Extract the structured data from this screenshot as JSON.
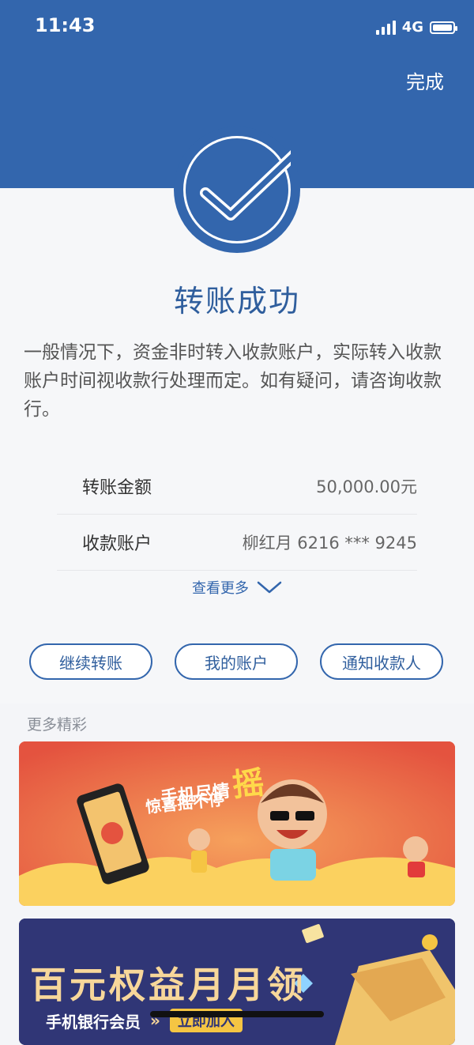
{
  "status_bar": {
    "time": "11:43",
    "network": "4G"
  },
  "header": {
    "done_label": "完成"
  },
  "result": {
    "title": "转账成功",
    "description": "一般情况下，资金非时转入收款账户，实际转入收款账户时间视收款行处理而定。如有疑问，请咨询收款行。"
  },
  "details": [
    {
      "label": "转账金额",
      "value": "50,000.00元"
    },
    {
      "label": "收款账户",
      "value": "柳红月 6216 *** 9245"
    }
  ],
  "more_label": "查看更多",
  "actions": [
    {
      "label": "继续转账"
    },
    {
      "label": "我的账户"
    },
    {
      "label": "通知收款人"
    }
  ],
  "section_title": "更多精彩",
  "banner1": {
    "line1": "手机尽情",
    "big": "摇",
    "line2": "惊喜摇不停"
  },
  "banner2": {
    "title": "百元权益月月领",
    "subtitle": "手机银行会员",
    "cta": "立即加入"
  },
  "colors": {
    "brand": "#3366ad",
    "banner1": "#e75c45",
    "banner2": "#303676"
  }
}
